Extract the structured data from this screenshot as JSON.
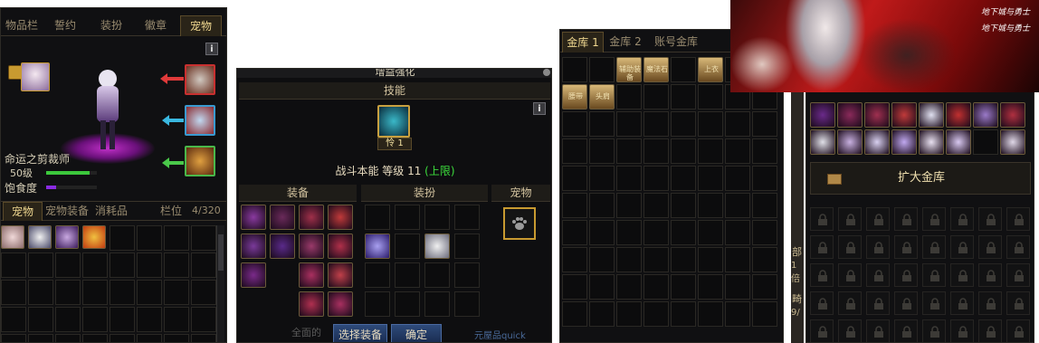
{
  "inventory": {
    "tabs": [
      "物品栏",
      "誓约",
      "装扮",
      "徽章",
      "宠物"
    ],
    "active_tab": "宠物",
    "info_label": "i",
    "pet_name": "命运之剪裁师",
    "level_label": "50级",
    "satiety_label": "饱食度",
    "sub_tabs": [
      "宠物",
      "宠物装备",
      "消耗品"
    ],
    "active_sub_tab": "宠物",
    "slot_label": "栏位",
    "slot_count": "4/320",
    "level_bar_fraction": 0.85,
    "satiety_bar_fraction": 0.2
  },
  "enhance": {
    "title": "增益强化",
    "skills_header": "技能",
    "skill_badge": "怜 1",
    "info_label": "i",
    "skill_line": "战斗本能 等级 11",
    "skill_cap": "(上限)",
    "equip_header": "装备",
    "avatar_header": "装扮",
    "pet_header": "宠物",
    "select_button": "选择装备",
    "confirm_button": "确定",
    "bottom_fragment_left": "全面的",
    "bottom_fragment_right": "元屋品quick"
  },
  "vault": {
    "tabs": [
      "金库 1",
      "金库 2",
      "账号金库"
    ],
    "active_tab": "金库 1",
    "item_labels": [
      "辅助装备",
      "魔法石",
      "上衣",
      "腰带",
      "头肩"
    ]
  },
  "account_vault": {
    "expand_button": "扩大金库",
    "banner_text": "地下城与勇士",
    "left_fragments": [
      "部",
      "1倍",
      "畸",
      "9/"
    ]
  },
  "colors": {
    "panel_bg": "#101012",
    "gold_text": "#f0d890",
    "green_level": "#3cc83c",
    "purple_satiety": "#8a2be2",
    "cap_green": "#3cdc3c",
    "button_blue": "#2e4a7a"
  },
  "icons": {
    "lock": "lock-icon",
    "info": "info-icon",
    "arrow": "arrow-left-icon",
    "paw": "paw-icon",
    "expand": "vault-expand-icon"
  }
}
